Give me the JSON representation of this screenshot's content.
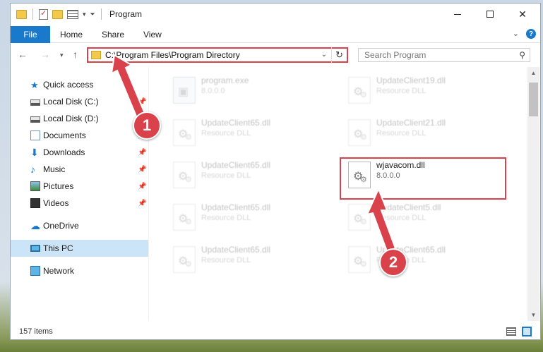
{
  "window": {
    "title": "Program"
  },
  "ribbon": {
    "tabs": [
      "File",
      "Home",
      "Share",
      "View"
    ]
  },
  "navbar": {
    "address": "C:\\Program Files\\Program Directory",
    "search_placeholder": "Search Program"
  },
  "sidebar": {
    "items": [
      {
        "label": "Quick access",
        "icon": "star-icon",
        "pinned": false
      },
      {
        "label": "Local Disk (C:)",
        "icon": "drive-icon",
        "pinned": true
      },
      {
        "label": "Local Disk (D:)",
        "icon": "drive-icon",
        "pinned": false
      },
      {
        "label": "Documents",
        "icon": "documents-icon",
        "pinned": true
      },
      {
        "label": "Downloads",
        "icon": "download-icon",
        "pinned": true
      },
      {
        "label": "Music",
        "icon": "music-icon",
        "pinned": true
      },
      {
        "label": "Pictures",
        "icon": "pictures-icon",
        "pinned": true
      },
      {
        "label": "Videos",
        "icon": "videos-icon",
        "pinned": true
      },
      {
        "label": "OneDrive",
        "icon": "cloud-icon",
        "pinned": false
      },
      {
        "label": "This PC",
        "icon": "computer-icon",
        "pinned": false,
        "selected": true
      },
      {
        "label": "Network",
        "icon": "network-icon",
        "pinned": false
      }
    ]
  },
  "files": [
    {
      "name": "program.exe",
      "detail": "8.0.0.0"
    },
    {
      "name": "UpdateClient19.dll",
      "detail": "Resource DLL"
    },
    {
      "name": "UpdateClient65.dll",
      "detail": "Resource DLL"
    },
    {
      "name": "UpdateClient21.dll",
      "detail": "Resource DLL"
    },
    {
      "name": "UpdateClient65.dll",
      "detail": "Resource DLL"
    },
    {
      "name": "wjavacom.dll",
      "detail": "8.0.0.0"
    },
    {
      "name": "UpdateClient65.dll",
      "detail": "Resource DLL"
    },
    {
      "name": "UpdateClient5.dll",
      "detail": "Resource DLL"
    },
    {
      "name": "UpdateClient65.dll",
      "detail": "Resource DLL"
    },
    {
      "name": "UpdateClient65.dll",
      "detail": "Resource DLL"
    }
  ],
  "status": {
    "item_count": "157 items"
  },
  "annotations": {
    "step1": "1",
    "step2": "2",
    "color": "#d9424a"
  }
}
